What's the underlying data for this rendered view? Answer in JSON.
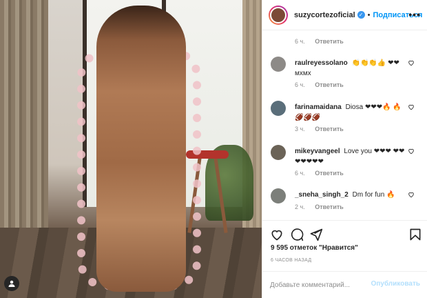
{
  "post_header": {
    "username": "suzycortezoficial",
    "separator": "•",
    "follow_label": "Подписаться",
    "more_label": "•••"
  },
  "previous_comment_meta": {
    "time": "6 ч.",
    "reply_label": "Ответить"
  },
  "comments": [
    {
      "username": "raulreyessolano",
      "text": "👏👏👏👍 ❤❤мхмх",
      "time": "6 ч.",
      "reply_label": "Ответить",
      "avatar_color": "#8d8a87"
    },
    {
      "username": "farinamaidana",
      "text": "Diosa ❤❤❤🔥 🔥🏈🏈🏈",
      "time": "3 ч.",
      "reply_label": "Ответить",
      "avatar_color": "#5a6e7a"
    },
    {
      "username": "mikeyvangeel",
      "text": "Love you ❤❤❤ ❤❤❤❤❤❤❤",
      "time": "6 ч.",
      "reply_label": "Ответить",
      "avatar_color": "#6b6357"
    },
    {
      "username": "_sneha_singh_2",
      "text": "Dm for fun 🔥",
      "time": "2 ч.",
      "reply_label": "Ответить",
      "avatar_color": "#7c7f7a"
    }
  ],
  "likes_text": "9 595 отметок \"Нравится\"",
  "post_time": "6 ЧАСОВ НАЗАД",
  "add_comment": {
    "placeholder": "Добавьте комментарий...",
    "post_label": "Опубликовать"
  },
  "colors": {
    "accent": "#0095f6",
    "verified": "#3897f0",
    "muted": "#8e8e8e",
    "publish_disabled": "#b2dffc"
  },
  "icons": {
    "like": "heart-icon",
    "comment": "comment-icon",
    "share": "paper-plane-icon",
    "save": "bookmark-icon",
    "user_tag": "user-icon"
  }
}
